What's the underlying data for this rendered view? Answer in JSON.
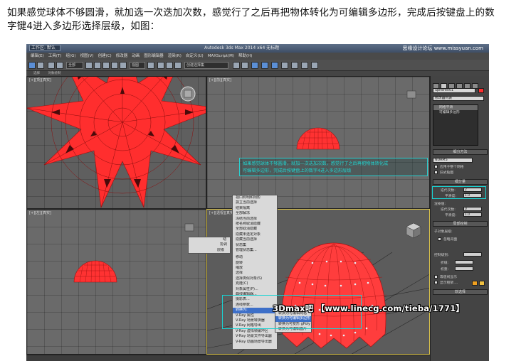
{
  "caption": {
    "line1": "如果感觉球体不够圆滑，就加选一次迭加次数，感觉行了之后再把物体转化为可编辑多边形，完成后按键盘上的数",
    "line2": "字键4进入多边形选择层级，如图："
  },
  "app": {
    "workspace": "工作区: 默认",
    "title": "Autodesk 3ds Max  2014 x64     无标题",
    "watermark": "思缘设计论坛 www.missyuan.com"
  },
  "menu": [
    "编辑(E)",
    "工具(T)",
    "组(G)",
    "视图(V)",
    "创建(C)",
    "修改器",
    "动画",
    "图形编辑器",
    "渲染(R)",
    "自定义(U)",
    "MAXScript(M)",
    "帮助(H)"
  ],
  "toolbar": {
    "filter": "全部",
    "view": "视图",
    "selection_set": "创建选择集"
  },
  "subbar": [
    "选择",
    "对象绘制"
  ],
  "viewports": {
    "top": "[+][顶][真实]",
    "front": "[+][前][真实]",
    "left": "[+][左][真实]",
    "persp": "[+][透视][真实]"
  },
  "annotation": {
    "line1": "如果感觉球体不够圆滑，就加一次迭加次数，感觉行了之后再把物体转化成",
    "line2": "可编辑多边形，完成后按键盘上的数字4进入多边形层级"
  },
  "context_menu_left": [
    "孤立当前选择",
    "全部解冻",
    "冻结当前选择"
  ],
  "context_menu_small": [
    "动",
    "协调",
    "层级"
  ],
  "quad_menu": [
    "视口照明和阴影",
    "孤立当前选择",
    "结束隔离",
    "全部解冻",
    "冻结当前选择",
    "按名称取消隐藏",
    "全部取消隐藏",
    "隐藏未选定对象",
    "隐藏当前选择",
    "状态集",
    "管理状态集...",
    "",
    "移动",
    "旋转",
    "缩放",
    "选择",
    "选择类似对象(S)",
    "克隆(C)",
    "对象属性(P)...",
    "曲线编辑器...",
    "摄影表...",
    "连线参数...",
    "转换为:",
    "V-Ray 属性",
    "V-Ray 场景转换器",
    "V-Ray 网格导出",
    "V-Ray 虚拟帧缓冲区",
    "V-Ray 场景文件导出器",
    "V-Ray 动画场景导出器"
  ],
  "quad_highlight_index": 22,
  "submenu": [
    "转换为可编辑网格",
    "转换为可编辑多边形",
    "转换为可变形 gPoly",
    "转换为可编辑面片"
  ],
  "submenu_highlight_index": 1,
  "command_panel": {
    "object_name": "Sphere001",
    "modifier_list": "修改器列表",
    "stack": [
      "网格平滑",
      "可编辑多边形"
    ],
    "rollouts": {
      "subdivision_method": "细分方法",
      "method_value": "NURMS",
      "apply_whole": "应用于整个网格",
      "old_style": "旧式贴图",
      "subdivision_amount": "细分量",
      "iterations_label": "迭代次数:",
      "iterations_value": "2",
      "smoothness_label": "平滑度:",
      "smoothness_value": "1.0",
      "render_label": "渲染值:",
      "render_iter": "迭代次数:",
      "render_iter_value": "0",
      "render_smooth": "平滑度:",
      "render_smooth_value": "1.0",
      "local_control": "局部控制",
      "sub_level": "子对象层级:",
      "ignore_backface": "忽略背面",
      "control_level": "控制级别:",
      "crease": "折缝:",
      "weight": "权重:",
      "isoline": "等值线显示",
      "show_cage": "显示框架....",
      "soft_select": "软选择"
    }
  },
  "watermark_bottom": "3Dmax吧  【www.linecg.com/tieba/1771】",
  "colors": {
    "object_red": "#ff3030",
    "highlight_blue": "#3d6fc8",
    "annotation_cyan": "#22d4cf"
  }
}
